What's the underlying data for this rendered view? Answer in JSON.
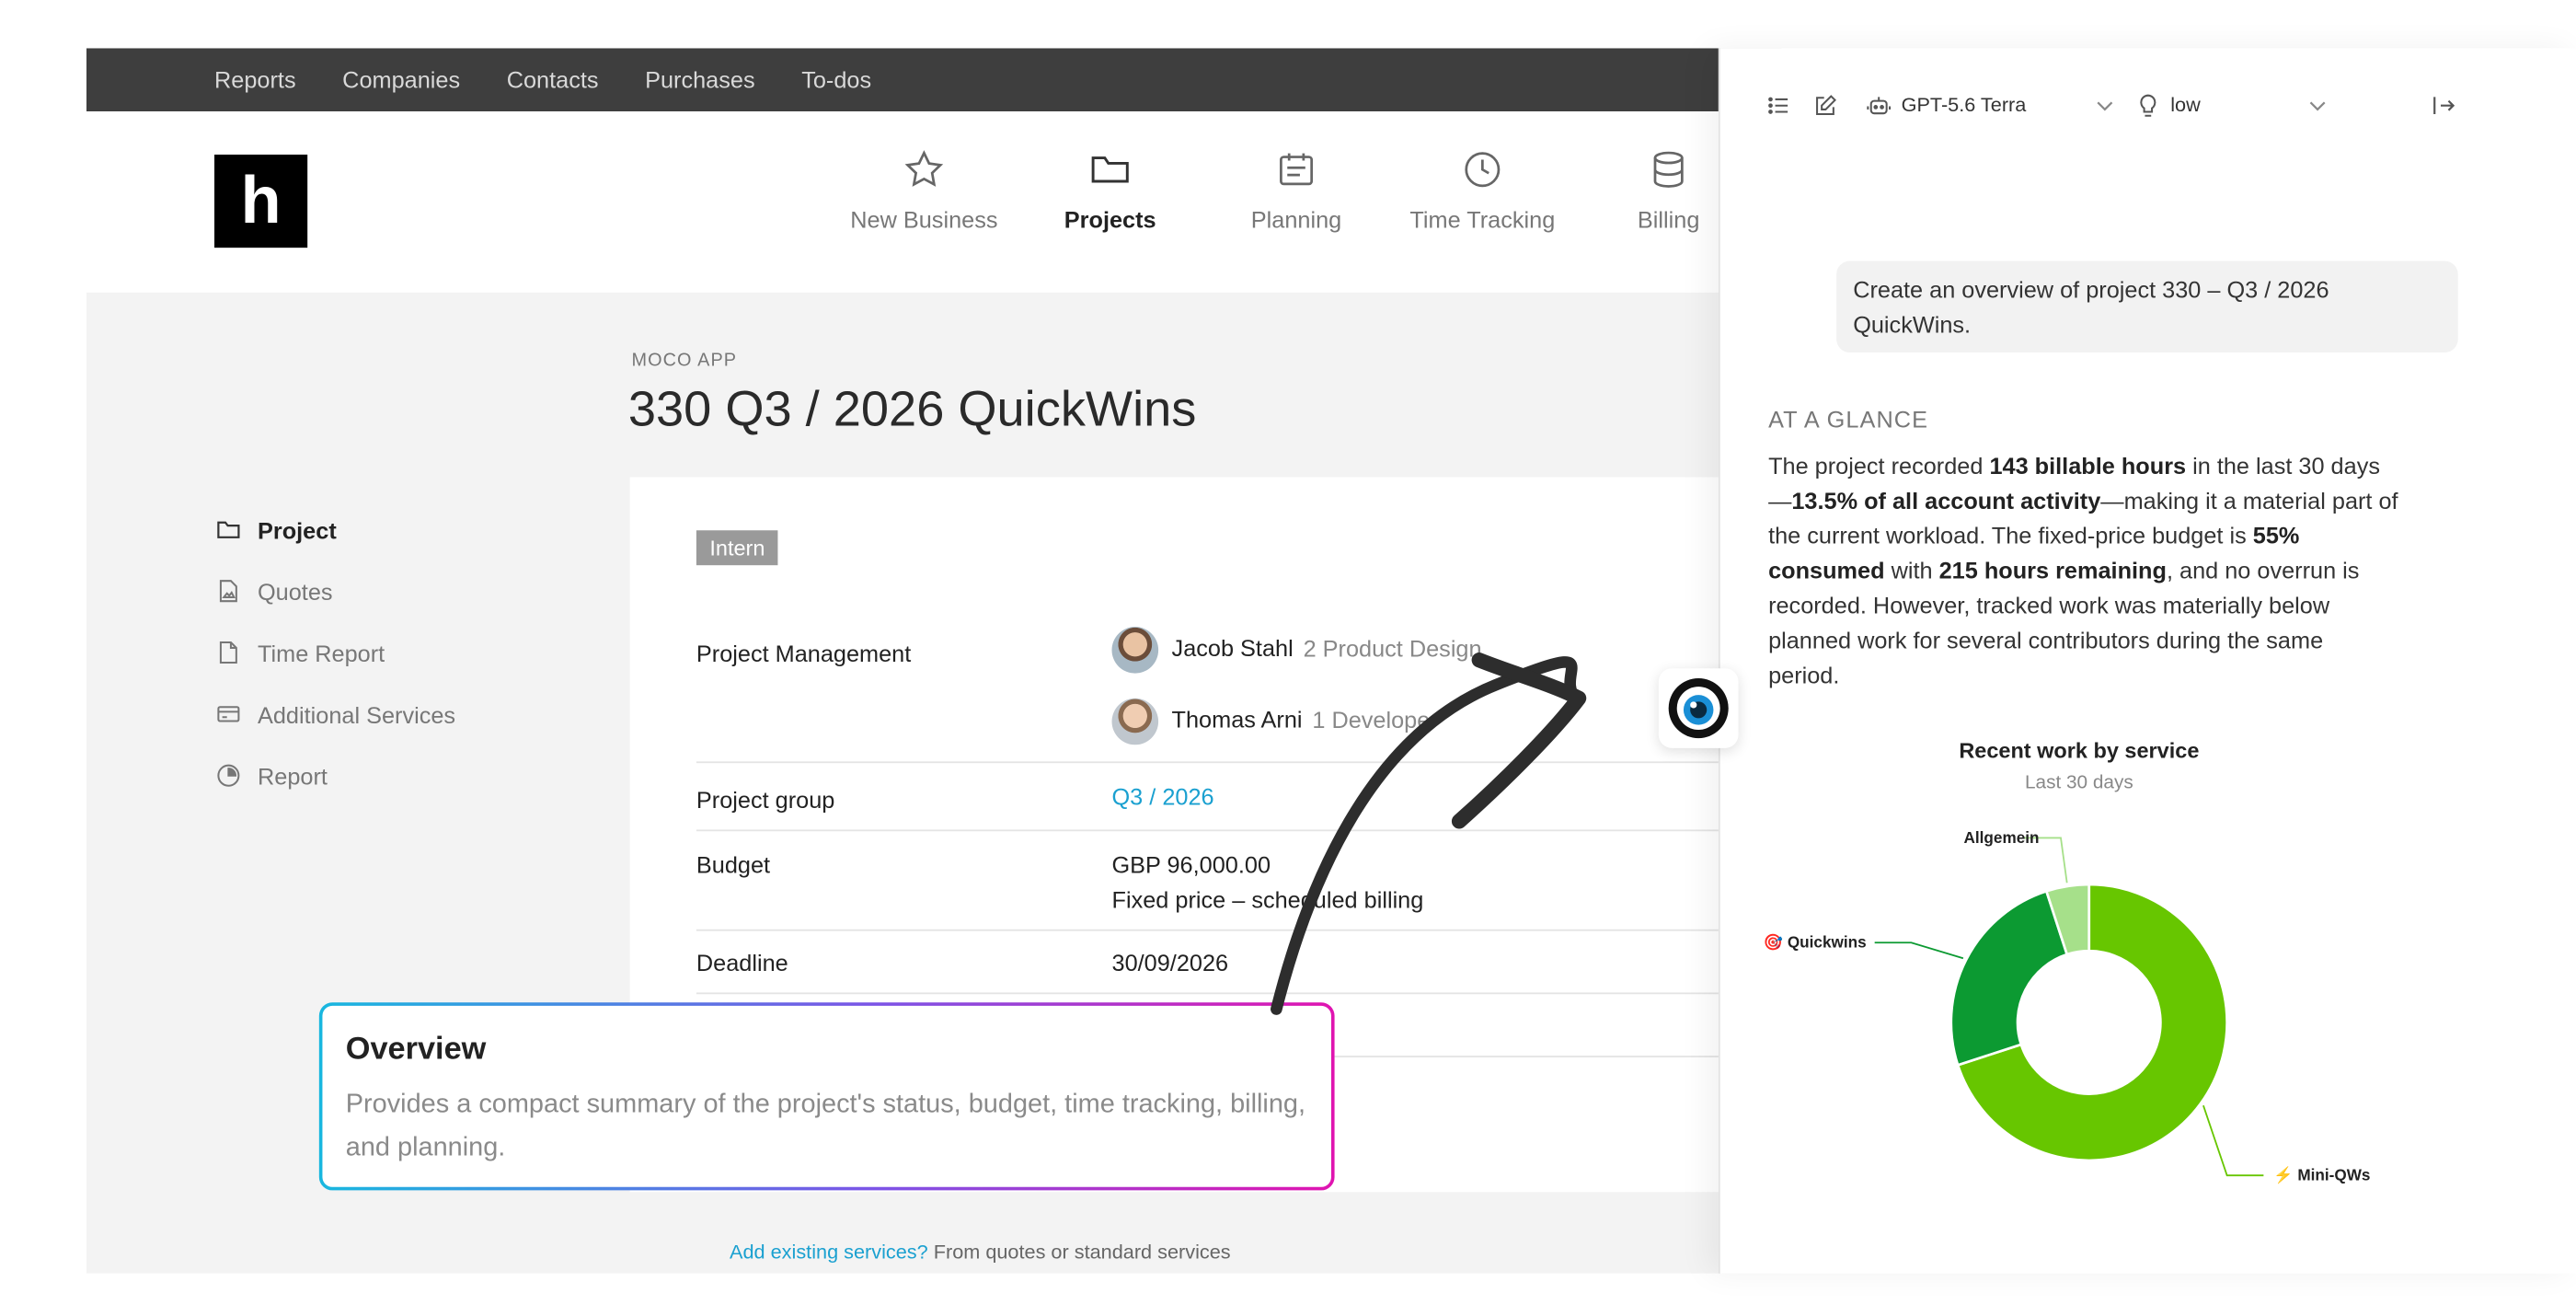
{
  "topnav": [
    "Reports",
    "Companies",
    "Contacts",
    "Purchases",
    "To-dos"
  ],
  "logo": "h",
  "mainnav": [
    {
      "label": "New Business",
      "icon": "star-icon"
    },
    {
      "label": "Projects",
      "icon": "folder-icon"
    },
    {
      "label": "Planning",
      "icon": "calendar-icon"
    },
    {
      "label": "Time Tracking",
      "icon": "clock-icon"
    },
    {
      "label": "Billing",
      "icon": "database-icon"
    }
  ],
  "project": {
    "crumb": "MOCO APP",
    "title": "330 Q3 / 2026 QuickWins",
    "tag": "Intern",
    "management_label": "Project Management",
    "managers": [
      {
        "name": "Jacob Stahl",
        "role": "2 Product Design"
      },
      {
        "name": "Thomas Arni",
        "role": "1 Developer"
      }
    ],
    "group_label": "Project group",
    "group_value": "Q3 / 2026",
    "budget_label": "Budget",
    "budget_value": "GBP 96,000.00",
    "budget_sub": "Fixed price – scheduled billing",
    "deadline_label": "Deadline",
    "deadline_value": "30/09/2026",
    "bottom_link": "Add existing services?",
    "bottom_text": " From quotes or standard services"
  },
  "sidenav": [
    {
      "label": "Project",
      "icon": "folder-icon"
    },
    {
      "label": "Quotes",
      "icon": "document-image-icon"
    },
    {
      "label": "Time Report",
      "icon": "document-icon"
    },
    {
      "label": "Additional Services",
      "icon": "card-icon"
    },
    {
      "label": "Report",
      "icon": "report-icon"
    }
  ],
  "callout": {
    "title": "Overview",
    "text": "Provides a compact summary of the project's status, budget, time tracking, billing, and planning."
  },
  "panel": {
    "model": "GPT-5.6 Terra",
    "effort": "low",
    "prompt": "Create an overview of project 330 – Q3 / 2026 QuickWins.",
    "glance_heading": "AT A GLANCE",
    "glance": [
      {
        "t": "The project recorded ",
        "b": false
      },
      {
        "t": "143 billable hours",
        "b": true
      },
      {
        "t": " in the last 30 days—",
        "b": false
      },
      {
        "t": "13.5% of all account activity",
        "b": true
      },
      {
        "t": "—making it a material part of the current workload. The fixed-price budget is ",
        "b": false
      },
      {
        "t": "55% consumed",
        "b": true
      },
      {
        "t": " with ",
        "b": false
      },
      {
        "t": "215 hours remaining",
        "b": true
      },
      {
        "t": ", and no overrun is recorded. However, tracked work was materially below planned work for several contributors during the same period.",
        "b": false
      }
    ]
  },
  "chart_data": {
    "type": "pie",
    "title": "Recent work by service",
    "subtitle": "Last 30 days",
    "donut": true,
    "categories": [
      "⚡ Mini-QWs",
      "🎯 Quickwins",
      "Allgemein"
    ],
    "values": [
      70,
      25,
      5
    ],
    "colors": [
      "#67c600",
      "#0c9a32",
      "#a6e08a"
    ]
  }
}
